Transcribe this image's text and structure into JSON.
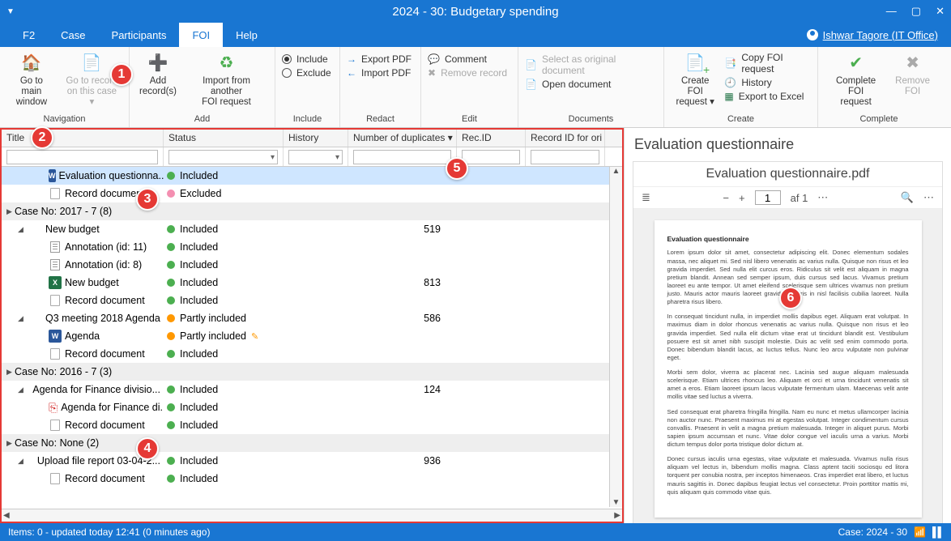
{
  "window": {
    "title": "2024 - 30: Budgetary spending"
  },
  "menu": {
    "tabs": [
      "F2",
      "Case",
      "Participants",
      "FOI",
      "Help"
    ],
    "active": "FOI",
    "user": "Ishwar Tagore (IT Office)"
  },
  "ribbon": {
    "nav": {
      "main": "Go to main\nwindow",
      "case": "Go to record\non this case ▾",
      "label": "Navigation"
    },
    "add": {
      "records": "Add\nrecord(s)",
      "import": "Import from another\nFOI request",
      "label": "Add"
    },
    "include": {
      "include": "Include",
      "exclude": "Exclude",
      "label": "Include"
    },
    "redact": {
      "exportpdf": "Export PDF",
      "importpdf": "Import PDF",
      "label": "Redact"
    },
    "edit": {
      "comment": "Comment",
      "remove": "Remove record",
      "label": "Edit"
    },
    "documents": {
      "selectorig": "Select as original document",
      "opendoc": "Open document",
      "label": "Documents"
    },
    "create": {
      "createfoi": "Create FOI\nrequest ▾",
      "copy": "Copy FOI request",
      "history": "History",
      "excel": "Export to Excel",
      "label": "Create"
    },
    "complete": {
      "completefoi": "Complete FOI\nrequest",
      "removefoi": "Remove\nFOI",
      "label": "Complete"
    }
  },
  "grid": {
    "columns": {
      "title": "Title",
      "status": "Status",
      "history": "History",
      "dup": "Number of duplicates ▾",
      "recid": "Rec.ID",
      "recori": "Record ID for ori"
    },
    "groups": [
      {
        "header": "",
        "rows": [
          {
            "indent": 1,
            "icon": "word",
            "title": "Evaluation questionna...",
            "status": "Included",
            "dot": "green",
            "dup": "",
            "selected": true
          },
          {
            "indent": 1,
            "icon": "doc",
            "title": "Record document",
            "status": "Excluded",
            "dot": "pink",
            "dup": ""
          }
        ]
      },
      {
        "header": "Case No: 2017 - 7 (8)",
        "rows": [
          {
            "indent": 0,
            "tri": true,
            "icon": "",
            "title": "New budget",
            "status": "Included",
            "dot": "green",
            "dup": "519"
          },
          {
            "indent": 1,
            "icon": "text",
            "title": "Annotation (id: 11)",
            "status": "Included",
            "dot": "green",
            "dup": ""
          },
          {
            "indent": 1,
            "icon": "text",
            "title": "Annotation (id: 8)",
            "status": "Included",
            "dot": "green",
            "dup": ""
          },
          {
            "indent": 1,
            "icon": "excel",
            "title": "New budget",
            "status": "Included",
            "dot": "green",
            "dup": "813"
          },
          {
            "indent": 1,
            "icon": "doc",
            "title": "Record document",
            "status": "Included",
            "dot": "green",
            "dup": ""
          },
          {
            "indent": 0,
            "tri": true,
            "icon": "",
            "title": "Q3 meeting 2018 Agenda",
            "status": "Partly included",
            "dot": "orange",
            "dup": "586"
          },
          {
            "indent": 1,
            "icon": "word",
            "title": "Agenda",
            "status": "Partly included",
            "dot": "orange",
            "dup": "",
            "pencil": true
          },
          {
            "indent": 1,
            "icon": "doc",
            "title": "Record document",
            "status": "Included",
            "dot": "green",
            "dup": ""
          }
        ]
      },
      {
        "header": "Case No: 2016 - 7 (3)",
        "rows": [
          {
            "indent": 0,
            "tri": true,
            "icon": "",
            "title": "Agenda for Finance divisio...",
            "status": "Included",
            "dot": "green",
            "dup": "124"
          },
          {
            "indent": 1,
            "icon": "pdf",
            "title": "Agenda for Finance di...",
            "status": "Included",
            "dot": "green",
            "dup": ""
          },
          {
            "indent": 1,
            "icon": "doc",
            "title": "Record document",
            "status": "Included",
            "dot": "green",
            "dup": ""
          }
        ]
      },
      {
        "header": "Case No: None (2)",
        "rows": [
          {
            "indent": 0,
            "tri": true,
            "icon": "",
            "title": "Upload file report 03-04-2...",
            "status": "Included",
            "dot": "green",
            "dup": "936"
          },
          {
            "indent": 1,
            "icon": "doc",
            "title": "Record document",
            "status": "Included",
            "dot": "green",
            "dup": ""
          }
        ]
      }
    ]
  },
  "preview": {
    "heading": "Evaluation questionnaire",
    "filename": "Evaluation questionnaire.pdf",
    "page": "1",
    "pagetotal": "af 1",
    "doctitle": "Evaluation questionnaire"
  },
  "statusbar": {
    "left": "Items: 0 - updated today 12:41 (0 minutes ago)",
    "right": "Case: 2024 - 30"
  },
  "badges": [
    "1",
    "2",
    "3",
    "4",
    "5",
    "6"
  ]
}
